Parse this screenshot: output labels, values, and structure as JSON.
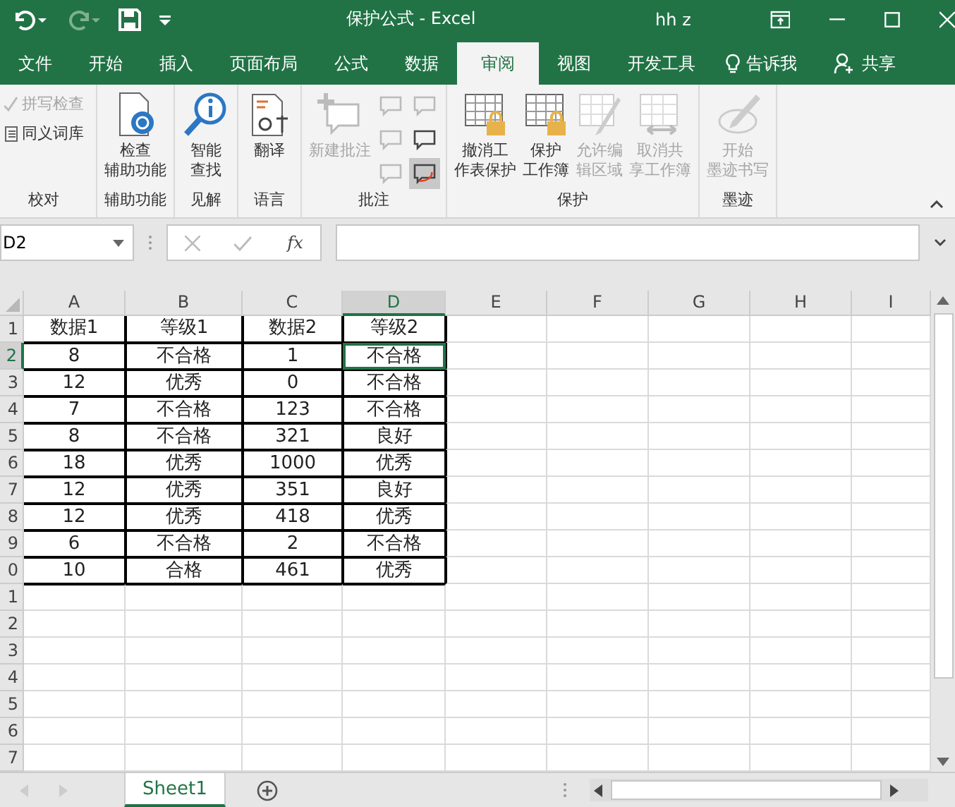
{
  "title_bar": {
    "title": "保护公式  -  Excel",
    "user": "hh z"
  },
  "tabs": [
    {
      "label": "文件",
      "selected": false
    },
    {
      "label": "开始",
      "selected": false
    },
    {
      "label": "插入",
      "selected": false
    },
    {
      "label": "页面布局",
      "selected": false
    },
    {
      "label": "公式",
      "selected": false
    },
    {
      "label": "数据",
      "selected": false
    },
    {
      "label": "审阅",
      "selected": true
    },
    {
      "label": "视图",
      "selected": false
    },
    {
      "label": "开发工具",
      "selected": false
    }
  ],
  "tell_me": "告诉我",
  "share": "共享",
  "ribbon_groups": [
    {
      "name": "校对",
      "kind": "small",
      "buttons": [
        {
          "lines": [
            "拼写检查"
          ],
          "disabled": true
        },
        {
          "lines": [
            "同义词库"
          ],
          "disabled": false
        }
      ]
    },
    {
      "name": "辅助功能",
      "kind": "large",
      "buttons": [
        {
          "lines": [
            "检查",
            "辅助功能"
          ],
          "disabled": false
        }
      ]
    },
    {
      "name": "见解",
      "kind": "large",
      "buttons": [
        {
          "lines": [
            "智能",
            "查找"
          ],
          "disabled": false
        }
      ]
    },
    {
      "name": "语言",
      "kind": "large",
      "buttons": [
        {
          "lines": [
            "翻译"
          ],
          "disabled": false
        }
      ]
    },
    {
      "name": "批注",
      "kind": "comments",
      "buttons": [
        {
          "lines": [
            "新建批注"
          ],
          "disabled": true
        }
      ],
      "tools": [
        {
          "disabled": true,
          "selected": false
        },
        {
          "disabled": true,
          "selected": false
        },
        {
          "disabled": true,
          "selected": false
        },
        {
          "disabled": false,
          "selected": false
        },
        {
          "disabled": true,
          "selected": false
        },
        {
          "disabled": false,
          "selected": true
        }
      ]
    },
    {
      "name": "保护",
      "kind": "large",
      "buttons": [
        {
          "lines": [
            "撤消工",
            "作表保护"
          ],
          "disabled": false
        },
        {
          "lines": [
            "保护",
            "工作簿"
          ],
          "disabled": false
        },
        {
          "lines": [
            "允许编",
            "辑区域"
          ],
          "disabled": true
        },
        {
          "lines": [
            "取消共",
            "享工作簿"
          ],
          "disabled": true
        }
      ]
    },
    {
      "name": "墨迹",
      "kind": "large",
      "buttons": [
        {
          "lines": [
            "开始",
            "墨迹书写"
          ],
          "disabled": true
        }
      ]
    }
  ],
  "formula_bar": {
    "name_box": "D2",
    "function_button": "fx"
  },
  "sheet": {
    "columns": [
      {
        "label": "A",
        "selected": false
      },
      {
        "label": "B",
        "selected": false
      },
      {
        "label": "C",
        "selected": false
      },
      {
        "label": "D",
        "selected": true
      },
      {
        "label": "E",
        "selected": false
      },
      {
        "label": "F",
        "selected": false
      },
      {
        "label": "G",
        "selected": false
      },
      {
        "label": "H",
        "selected": false
      },
      {
        "label": "I",
        "selected": false
      }
    ],
    "rows": [
      {
        "number": "1",
        "selected": false,
        "cells": [
          "数据1",
          "等级1",
          "数据2",
          "等级2"
        ]
      },
      {
        "number": "2",
        "selected": true,
        "cells": [
          "8",
          "不合格",
          "1",
          "不合格"
        ]
      },
      {
        "number": "3",
        "selected": false,
        "cells": [
          "12",
          "优秀",
          "0",
          "不合格"
        ]
      },
      {
        "number": "4",
        "selected": false,
        "cells": [
          "7",
          "不合格",
          "123",
          "不合格"
        ]
      },
      {
        "number": "5",
        "selected": false,
        "cells": [
          "8",
          "不合格",
          "321",
          "良好"
        ]
      },
      {
        "number": "6",
        "selected": false,
        "cells": [
          "18",
          "优秀",
          "1000",
          "优秀"
        ]
      },
      {
        "number": "7",
        "selected": false,
        "cells": [
          "12",
          "优秀",
          "351",
          "良好"
        ]
      },
      {
        "number": "8",
        "selected": false,
        "cells": [
          "12",
          "优秀",
          "418",
          "优秀"
        ]
      },
      {
        "number": "9",
        "selected": false,
        "cells": [
          "6",
          "不合格",
          "2",
          "不合格"
        ]
      },
      {
        "number": "0",
        "selected": false,
        "cells": [
          "10",
          "合格",
          "461",
          "优秀"
        ]
      },
      {
        "number": "1",
        "selected": false,
        "cells": []
      },
      {
        "number": "2",
        "selected": false,
        "cells": []
      },
      {
        "number": "3",
        "selected": false,
        "cells": []
      },
      {
        "number": "4",
        "selected": false,
        "cells": []
      },
      {
        "number": "5",
        "selected": false,
        "cells": []
      },
      {
        "number": "6",
        "selected": false,
        "cells": []
      },
      {
        "number": "7",
        "selected": false,
        "cells": []
      }
    ]
  },
  "sheet_tabs": [
    {
      "label": "Sheet1",
      "selected": true
    }
  ]
}
